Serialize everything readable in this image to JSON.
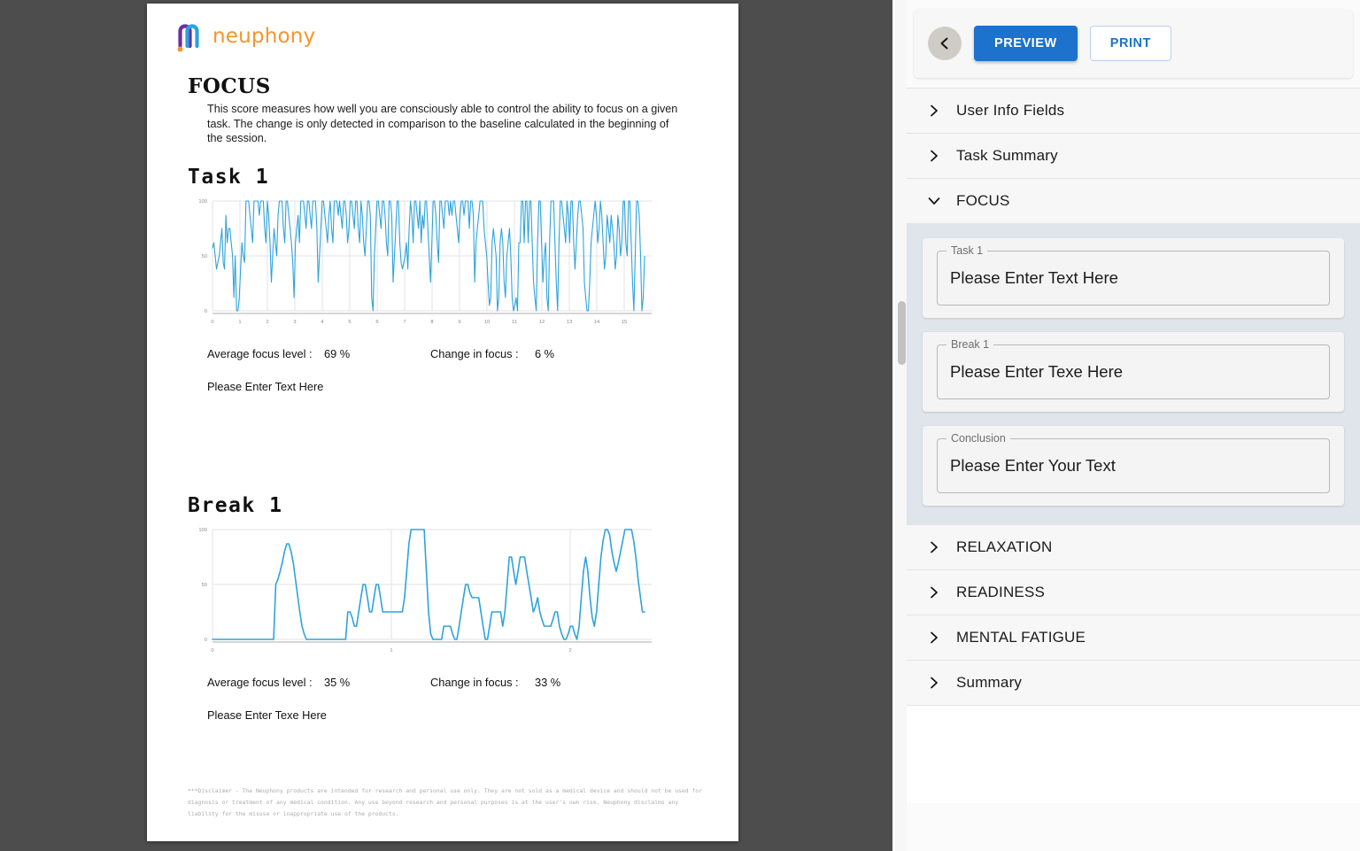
{
  "document": {
    "brand": {
      "name": "neuphony",
      "logo_icon": "neuphony-logo-icon",
      "text_color": "#F5952B"
    },
    "section_title": "FOCUS",
    "section_description": "This score measures how well you are consciously able to control the ability to focus on a given task. The change is only detected in comparison to the baseline calculated in the beginning of the session.",
    "blocks": [
      {
        "heading": "Task 1",
        "avg_label": "Average focus level :",
        "avg_value": "69 %",
        "change_label": "Change in focus :",
        "change_value": "6 %",
        "note": "Please Enter Text Here"
      },
      {
        "heading": "Break 1",
        "avg_label": "Average focus level :",
        "avg_value": "35 %",
        "change_label": "Change in focus :",
        "change_value": "33 %",
        "note": "Please Enter Texe Here"
      }
    ],
    "disclaimer": "***Disclaimer - The Neuphony products are intended for research and personal use only. They are not sold as a medical device and should not be used for diagnosis or treatment of any medical condition. Any use beyond research and personal purposes is at the user's own risk. Neuphony disclaims any liability for the misuse or inappropriate use of the products."
  },
  "chart_data": [
    {
      "type": "line",
      "title": "Task 1",
      "xlabel": "",
      "ylabel": "",
      "line_color": "#2EA3DC",
      "grid": true,
      "xlim": [
        0,
        15.7
      ],
      "ylim": [
        0,
        100
      ],
      "xticks": [
        0,
        1,
        2,
        3,
        4,
        5,
        6,
        7,
        8,
        9,
        10,
        11,
        12,
        13,
        14,
        15
      ],
      "yticks": [
        0,
        50,
        100
      ],
      "values": [
        57,
        62,
        50,
        38,
        44,
        50,
        62,
        75,
        44,
        38,
        87,
        62,
        75,
        75,
        62,
        50,
        12,
        50,
        0,
        0,
        12,
        38,
        62,
        50,
        44,
        100,
        100,
        100,
        87,
        75,
        62,
        100,
        100,
        100,
        100,
        87,
        100,
        100,
        100,
        75,
        62,
        100,
        87,
        62,
        26,
        50,
        75,
        62,
        50,
        87,
        100,
        100,
        100,
        75,
        62,
        100,
        100,
        87,
        75,
        62,
        44,
        12,
        62,
        75,
        87,
        62,
        100,
        100,
        100,
        87,
        75,
        100,
        100,
        87,
        75,
        100,
        100,
        100,
        75,
        26,
        50,
        75,
        100,
        100,
        87,
        75,
        62,
        87,
        100,
        75,
        62,
        100,
        100,
        100,
        87,
        100,
        87,
        75,
        100,
        100,
        87,
        62,
        75,
        100,
        100,
        87,
        75,
        100,
        100,
        75,
        62,
        100,
        87,
        62,
        50,
        75,
        100,
        100,
        87,
        12,
        0,
        50,
        75,
        100,
        100,
        87,
        75,
        100,
        100,
        87,
        62,
        50,
        100,
        100,
        87,
        26,
        50,
        75,
        100,
        100,
        62,
        44,
        38,
        44,
        50,
        62,
        38,
        75,
        100,
        87,
        62,
        100,
        100,
        87,
        75,
        100,
        62,
        87,
        75,
        100,
        100,
        75,
        50,
        26,
        62,
        100,
        100,
        87,
        62,
        44,
        100,
        100,
        87,
        75,
        100,
        100,
        100,
        87,
        100,
        87,
        100,
        100,
        87,
        75,
        62,
        87,
        100,
        100,
        87,
        100,
        100,
        100,
        75,
        100,
        100,
        87,
        26,
        62,
        75,
        87,
        100,
        100,
        100,
        75,
        62,
        50,
        26,
        5,
        12,
        62,
        75,
        62,
        50,
        0,
        12,
        62,
        75,
        62,
        26,
        12,
        50,
        62,
        75,
        50,
        12,
        0,
        5,
        12,
        0,
        62,
        62,
        100,
        100,
        62,
        100,
        100,
        62,
        100,
        100,
        62,
        26,
        12,
        0,
        62,
        100,
        100,
        62,
        26,
        50,
        62,
        12,
        0,
        62,
        100,
        100,
        100,
        62,
        26,
        0,
        62,
        100,
        100,
        87,
        75,
        62,
        100,
        87,
        62,
        100,
        100,
        62,
        38,
        62,
        87,
        100,
        100,
        87,
        75,
        26,
        12,
        0,
        0,
        26,
        62,
        75,
        87,
        100,
        87,
        62,
        75,
        100,
        87,
        62,
        38,
        50,
        87,
        75,
        62,
        87,
        75,
        62,
        38,
        50,
        87,
        75,
        50,
        62,
        100,
        100,
        62,
        50,
        100,
        100,
        62,
        26,
        0,
        50,
        100,
        100,
        87,
        50,
        0,
        12,
        50
      ],
      "description": "Dense high-frequency focus signal oscillating between 0 and 100 over ~15.7 minutes"
    },
    {
      "type": "line",
      "title": "Break 1",
      "xlabel": "",
      "ylabel": "",
      "line_color": "#2EA3DC",
      "grid": true,
      "xlim": [
        0,
        2.45
      ],
      "ylim": [
        0,
        100
      ],
      "xticks": [
        0,
        1,
        2
      ],
      "yticks": [
        0,
        50,
        100
      ],
      "values": [
        0,
        0,
        0,
        0,
        0,
        0,
        0,
        0,
        0,
        0,
        0,
        0,
        0,
        0,
        0,
        0,
        0,
        0,
        0,
        0,
        0,
        0,
        0,
        0,
        0,
        0,
        0,
        0,
        0,
        50,
        55,
        62,
        70,
        80,
        87,
        87,
        80,
        70,
        55,
        40,
        25,
        12,
        5,
        0,
        0,
        0,
        0,
        0,
        0,
        0,
        0,
        0,
        0,
        0,
        0,
        0,
        0,
        0,
        0,
        0,
        0,
        0,
        25,
        25,
        20,
        12,
        12,
        25,
        38,
        50,
        50,
        38,
        25,
        25,
        38,
        50,
        50,
        38,
        25,
        25,
        25,
        25,
        25,
        25,
        25,
        25,
        25,
        25,
        38,
        62,
        87,
        100,
        100,
        100,
        100,
        100,
        100,
        100,
        62,
        25,
        5,
        0,
        0,
        0,
        0,
        0,
        12,
        12,
        12,
        12,
        5,
        0,
        0,
        12,
        25,
        38,
        50,
        50,
        42,
        38,
        38,
        38,
        38,
        25,
        12,
        0,
        0,
        12,
        25,
        25,
        25,
        25,
        25,
        12,
        25,
        50,
        75,
        75,
        62,
        50,
        62,
        75,
        75,
        75,
        62,
        50,
        38,
        25,
        30,
        38,
        25,
        18,
        12,
        12,
        12,
        12,
        18,
        25,
        25,
        12,
        5,
        0,
        0,
        5,
        12,
        12,
        5,
        0,
        12,
        38,
        62,
        75,
        62,
        38,
        20,
        12,
        25,
        50,
        75,
        90,
        100,
        100,
        95,
        80,
        70,
        62,
        70,
        80,
        90,
        100,
        100,
        100,
        100,
        90,
        75,
        55,
        40,
        25,
        25
      ],
      "description": "Smoother focus signal over ~2.45 minutes, dipping to 0 and peaking at 100"
    }
  ],
  "editor": {
    "toolbar": {
      "back_icon": "chevron-left-icon",
      "preview_label": "PREVIEW",
      "print_label": "PRINT",
      "preview_color": "#1C72CC"
    },
    "sections": [
      {
        "label": "User Info Fields",
        "expanded": false,
        "icon": "chevron-right-icon"
      },
      {
        "label": "Task Summary",
        "expanded": false,
        "icon": "chevron-right-icon"
      },
      {
        "label": "FOCUS",
        "expanded": true,
        "icon": "chevron-down-icon"
      },
      {
        "label": "RELAXATION",
        "expanded": false,
        "icon": "chevron-right-icon"
      },
      {
        "label": "READINESS",
        "expanded": false,
        "icon": "chevron-right-icon"
      },
      {
        "label": "MENTAL FATIGUE",
        "expanded": false,
        "icon": "chevron-right-icon"
      },
      {
        "label": "Summary",
        "expanded": false,
        "icon": "chevron-right-icon"
      }
    ],
    "focus_fields": [
      {
        "legend": "Task 1",
        "value": "Please Enter Text Here"
      },
      {
        "legend": "Break 1",
        "value": "Please Enter Texe Here"
      },
      {
        "legend": "Conclusion",
        "value": "Please Enter Your Text"
      }
    ]
  }
}
